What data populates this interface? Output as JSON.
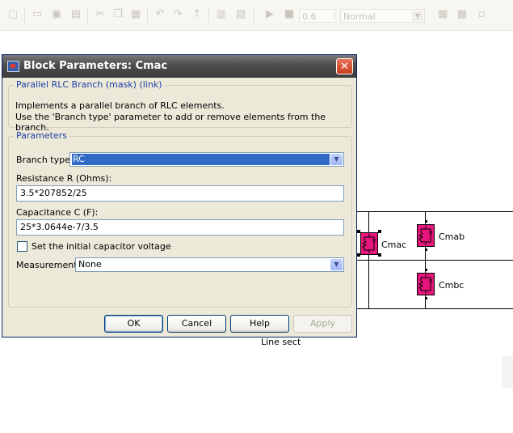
{
  "toolbar": {
    "zoom_value": "0.6",
    "mode_value": "Normal"
  },
  "dialog": {
    "title": "Block Parameters: Cmac",
    "close_glyph": "✕",
    "block_group_legend": "Parallel RLC Branch (mask) (link)",
    "description_line1": "Implements a parallel branch of RLC elements.",
    "description_line2": "Use the 'Branch type' parameter to add or remove elements from the branch.",
    "params_legend": "Parameters",
    "branch_type_label": "Branch type:",
    "branch_type_value": "RC",
    "resistance_label": "Resistance R (Ohms):",
    "resistance_value": "3.5*207852/25",
    "capacitance_label": "Capacitance C (F):",
    "capacitance_value": "25*3.0644e-7/3.5",
    "initial_voltage_label": "Set the initial capacitor voltage",
    "initial_voltage_checked": false,
    "measurements_label": "Measurements",
    "measurements_value": "None",
    "buttons": {
      "ok": "OK",
      "cancel": "Cancel",
      "help": "Help",
      "apply": "Apply"
    }
  },
  "diagram": {
    "blocks": [
      "Cmac",
      "Cmab",
      "Cmbc"
    ],
    "subsystem_label_partial": "Line sect",
    "block_color": "#e8157c"
  }
}
